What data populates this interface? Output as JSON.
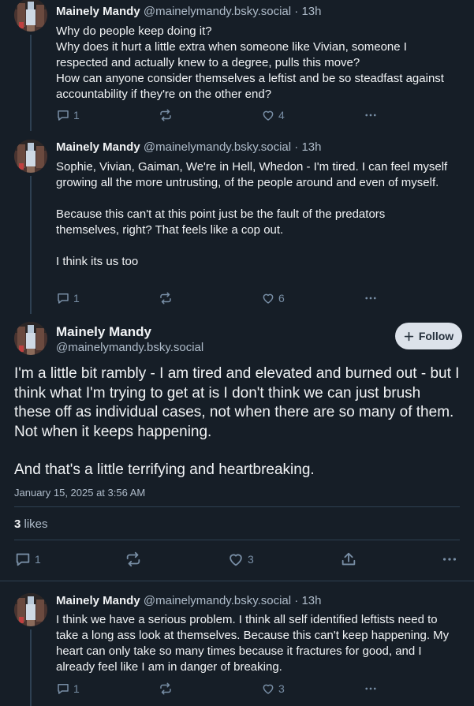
{
  "posts": [
    {
      "author_name": "Mainely Mandy",
      "author_handle": "@mainelymandy.bsky.social",
      "time": "· 13h",
      "lines": [
        "Why do people keep doing it?",
        "Why does it hurt a little extra when someone like Vivian, someone I respected and actually knew to a degree, pulls this move?",
        "How can anyone consider themselves a leftist and be so steadfast against accountability if they're on the other end?"
      ],
      "reply_count": "1",
      "repost_count": "",
      "like_count": "4"
    },
    {
      "author_name": "Mainely Mandy",
      "author_handle": "@mainelymandy.bsky.social",
      "time": "· 13h",
      "lines": [
        "Sophie, Vivian, Gaiman, We're in Hell, Whedon - I'm tired. I can feel myself growing all the more untrusting, of the people around and even of myself.",
        "",
        "Because this can't at this point just be the fault of the predators themselves, right? That feels like a cop out.",
        "",
        "I think its us too"
      ],
      "reply_count": "1",
      "repost_count": "",
      "like_count": "6"
    }
  ],
  "main_post": {
    "author_name": "Mainely Mandy",
    "author_handle": "@mainelymandy.bsky.social",
    "follow_label": "Follow",
    "paragraphs": [
      "I'm a little bit rambly - I am tired and elevated and burned out - but I think what I'm trying to get at is I don't think we can just brush these off as individual cases, not when there are so many of them. Not when it keeps happening.",
      "",
      "And that's a little terrifying and heartbreaking."
    ],
    "timestamp": "January 15, 2025 at 3:56 AM",
    "likes_count": "3",
    "likes_label": "likes",
    "reply_count": "1",
    "like_count": "3"
  },
  "reply_post": {
    "author_name": "Mainely Mandy",
    "author_handle": "@mainelymandy.bsky.social",
    "time": "· 13h",
    "text": "I think we have a serious problem. I think all self identified leftists need to take a long ass look at themselves. Because this can't keep happening. My heart can only take so many times because it fractures for good, and I already feel like I am in danger of breaking.",
    "reply_count": "1",
    "like_count": "3"
  },
  "icons": [
    "reply-icon",
    "repost-icon",
    "like-icon",
    "more-icon",
    "share-icon",
    "plus-icon"
  ],
  "colors": {
    "background": "#161e27",
    "muted": "#788ea5",
    "divider": "#2e4052",
    "follow_bg": "#dce2ea"
  }
}
